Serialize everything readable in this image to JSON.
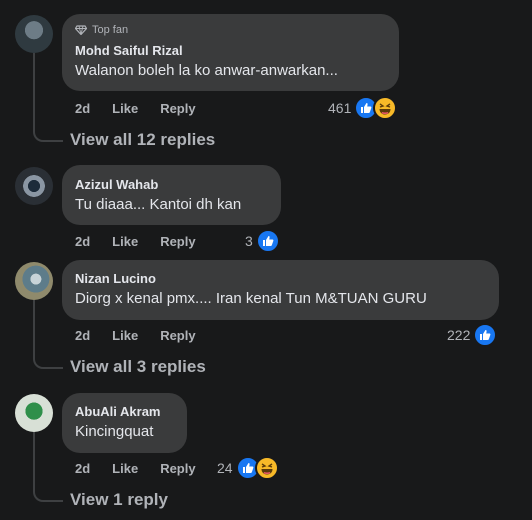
{
  "comments": [
    {
      "badge": "Top fan",
      "author": "Mohd Saiful Rizal",
      "text": "Walanon boleh la ko anwar-anwarkan...",
      "time": "2d",
      "like_label": "Like",
      "reply_label": "Reply",
      "reaction_count": "461",
      "reactions": [
        "like",
        "haha"
      ],
      "view_replies": "View all 12 replies"
    },
    {
      "author": "Azizul Wahab",
      "text": "Tu diaaa... Kantoi dh kan",
      "time": "2d",
      "like_label": "Like",
      "reply_label": "Reply",
      "reaction_count": "3",
      "reactions": [
        "like"
      ]
    },
    {
      "author": "Nizan Lucino",
      "text": "Diorg x kenal pmx.... Iran kenal Tun M&TUAN GURU",
      "time": "2d",
      "like_label": "Like",
      "reply_label": "Reply",
      "reaction_count": "222",
      "reactions": [
        "like"
      ],
      "view_replies": "View all 3 replies"
    },
    {
      "author": "AbuAli Akram",
      "text": "Kincingquat",
      "time": "2d",
      "like_label": "Like",
      "reply_label": "Reply",
      "reaction_count": "24",
      "reactions": [
        "like",
        "haha"
      ],
      "view_replies": "View 1 reply"
    }
  ],
  "colors": {
    "background": "#18191a",
    "bubble": "#3a3b3c",
    "like_blue": "#1877f2",
    "haha_yellow": "#f7b928",
    "secondary_text": "#b0b3b8"
  }
}
